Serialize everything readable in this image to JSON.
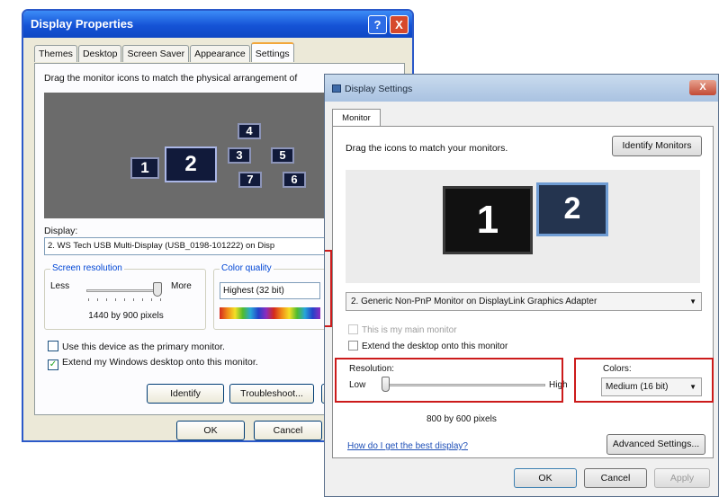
{
  "xp_window": {
    "title": "Display Properties",
    "help_button": "?",
    "close_button": "X",
    "tabs": [
      "Themes",
      "Desktop",
      "Screen Saver",
      "Appearance",
      "Settings"
    ],
    "instruction": "Drag the monitor icons to match the physical arrangement of",
    "monitors": [
      "1",
      "2",
      "3",
      "4",
      "5",
      "6",
      "7"
    ],
    "display_label": "Display:",
    "display_value": "2. WS Tech USB Multi-Display (USB_0198-101222) on Disp",
    "resolution_group": "Screen resolution",
    "less": "Less",
    "more": "More",
    "resolution_value": "1440 by 900 pixels",
    "color_group": "Color quality",
    "color_value": "Highest (32 bit)",
    "check_primary": "Use this device as the primary monitor.",
    "check_extend": "Extend my Windows desktop onto this monitor.",
    "identify_button": "Identify",
    "troubleshoot_button": "Troubleshoot...",
    "ok_button": "OK",
    "cancel_button": "Cancel"
  },
  "vista_window": {
    "title": "Display Settings",
    "close_button": "X",
    "tab": "Monitor",
    "instruction": "Drag the icons to match your monitors.",
    "identify_button": "Identify Monitors",
    "monitors": [
      "1",
      "2"
    ],
    "adapter_value": "2. Generic Non-PnP Monitor on DisplayLink Graphics Adapter",
    "check_main": "This is my main monitor",
    "check_extend": "Extend the desktop onto this monitor",
    "resolution_label": "Resolution:",
    "low": "Low",
    "high": "High",
    "resolution_value": "800 by 600 pixels",
    "colors_label": "Colors:",
    "colors_value": "Medium (16 bit)",
    "help_link": "How do I get the best display?",
    "advanced_button": "Advanced Settings...",
    "ok_button": "OK",
    "cancel_button": "Cancel",
    "apply_button": "Apply"
  },
  "colors": {
    "xp_title": "#1553d6",
    "highlight": "#cc1b1b",
    "vista_monitor_1": "#111111",
    "vista_monitor_2": "#24344f"
  }
}
